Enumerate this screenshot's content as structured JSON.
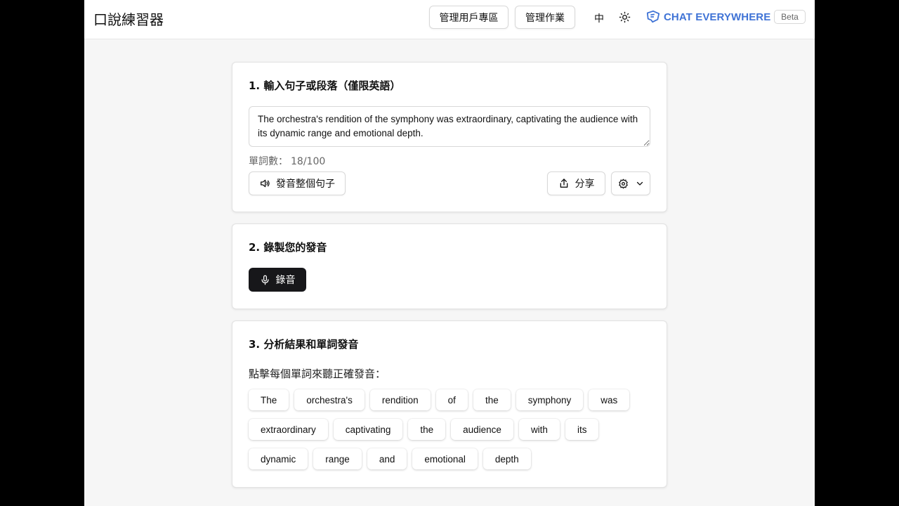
{
  "header": {
    "app_title": "口說練習器",
    "manage_users_label": "管理用戶專區",
    "manage_assignments_label": "管理作業",
    "language_label": "中",
    "brand_name": "CHAT EVERYWHERE",
    "beta_label": "Beta",
    "brand_color": "#3f73d6"
  },
  "input_section": {
    "title": "1. 輸入句子或段落（僅限英語）",
    "text_value": "The orchestra's rendition of the symphony was extraordinary, captivating the audience with its dynamic range and emotional depth.",
    "word_count_label": "單詞數：",
    "word_count_value": "18/100",
    "speak_all_label": "發音整個句子",
    "share_label": "分享"
  },
  "record_section": {
    "title": "2. 錄製您的發音",
    "record_label": "錄音"
  },
  "analysis_section": {
    "title": "3. 分析結果和單詞發音",
    "hint": "點擊每個單詞來聽正確發音：",
    "words": [
      "The",
      "orchestra's",
      "rendition",
      "of",
      "the",
      "symphony",
      "was",
      "extraordinary",
      "captivating",
      "the",
      "audience",
      "with",
      "its",
      "dynamic",
      "range",
      "and",
      "emotional",
      "depth"
    ]
  }
}
